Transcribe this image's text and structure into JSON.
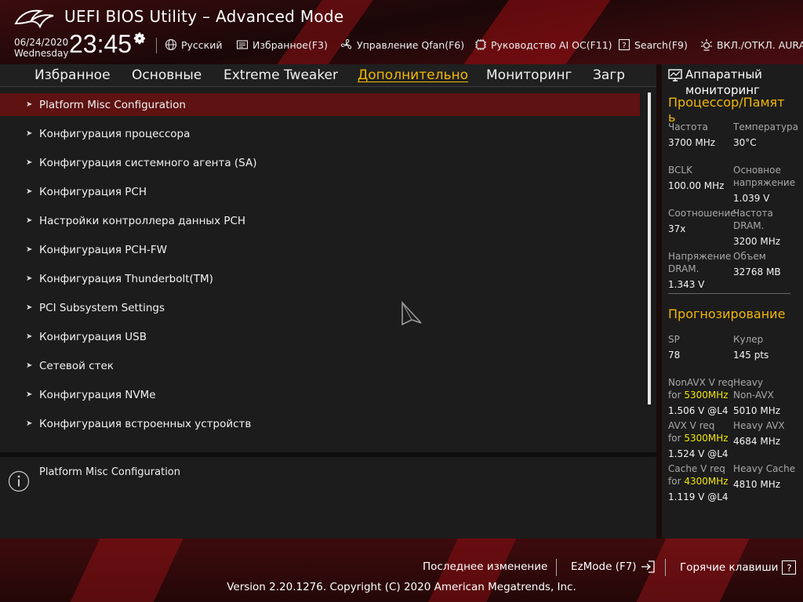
{
  "header": {
    "title": "UEFI BIOS Utility – Advanced Mode",
    "date": "06/24/2020",
    "weekday": "Wednesday",
    "time": "23:45",
    "items": {
      "language": "Русский",
      "favorites": "Избранное(F3)",
      "qfan": "Управление Qfan(F6)",
      "ai_oc": "Руководство AI OC(F11)",
      "search": "Search(F9)",
      "aura": "ВКЛ./ОТКЛ. AURA("
    }
  },
  "tabs": [
    {
      "label": "Избранное"
    },
    {
      "label": "Основные"
    },
    {
      "label": "Extreme Tweaker"
    },
    {
      "label": "Дополнительно",
      "active": true
    },
    {
      "label": "Мониторинг"
    },
    {
      "label": "Загр"
    }
  ],
  "menu": [
    "Platform Misc Configuration",
    "Конфигурация процессора",
    "Конфигурация системного агента (SA)",
    "Конфигурация PCH",
    "Настройки контроллера данных PCH",
    "Конфигурация PCH-FW",
    "Конфигурация Thunderbolt(TM)",
    "PCI Subsystem Settings",
    "Конфигурация USB",
    "Сетевой стек",
    "Конфигурация NVMe",
    "Конфигурация встроенных устройств"
  ],
  "selected_index": 0,
  "help_text": "Platform Misc Configuration",
  "hw_monitor": {
    "title_line1": "Аппаратный",
    "title_line2": "мониторинг",
    "cpu_mem_title_1": "Процессор/Памят",
    "cpu_mem_title_2": "ь",
    "freq_label": "Частота",
    "freq_value": "3700 MHz",
    "temp_label": "Температура",
    "temp_value": "30°C",
    "bclk_label": "BCLK",
    "bclk_value": "100.00 MHz",
    "core_v_label_1": "Основное",
    "core_v_label_2": "напряжение",
    "core_v_value": "1.039 V",
    "ratio_label": "Соотношение",
    "ratio_value": "37x",
    "dram_freq_label_1": "Частота",
    "dram_freq_label_2": "DRAM.",
    "dram_freq_value": "3200 MHz",
    "dram_v_label_1": "Напряжение",
    "dram_v_label_2": "DRAM.",
    "dram_v_value": "1.343 V",
    "capacity_label": "Объем",
    "capacity_value": "32768 MB",
    "prediction_title": "Прогнозирование",
    "sp_label": "SP",
    "sp_value": "78",
    "cooler_label": "Кулер",
    "cooler_value": "145 pts",
    "nonavx_label_1": "NonAVX V req",
    "nonavx_for": "for ",
    "nonavx_freq": "5300MHz",
    "nonavx_value": "1.506 V @L4",
    "heavy_nonavx_label_1": "Heavy",
    "heavy_nonavx_label_2": "Non-AVX",
    "heavy_nonavx_value": "5010 MHz",
    "avx_label_1": "AVX V req",
    "avx_for": "for ",
    "avx_freq": "5300MHz",
    "avx_value": "1.524 V @L4",
    "heavy_avx_label": "Heavy AVX",
    "heavy_avx_value": "4684 MHz",
    "cache_label_1": "Cache V req",
    "cache_for": "for ",
    "cache_freq": "4300MHz",
    "cache_value": "1.119 V @L4",
    "heavy_cache_label": "Heavy Cache",
    "heavy_cache_value": "4810 MHz"
  },
  "footer": {
    "last_change": "Последнее изменение",
    "ezmode": "EzMode (F7)",
    "hotkeys": "Горячие клавиши",
    "hotkey_glyph": "?",
    "copyright": "Version 2.20.1276. Copyright (C) 2020 American Megatrends, Inc."
  },
  "colors": {
    "accent": "#f2b705",
    "selected_row": "#5e1212",
    "highlight": "#f2e600"
  }
}
